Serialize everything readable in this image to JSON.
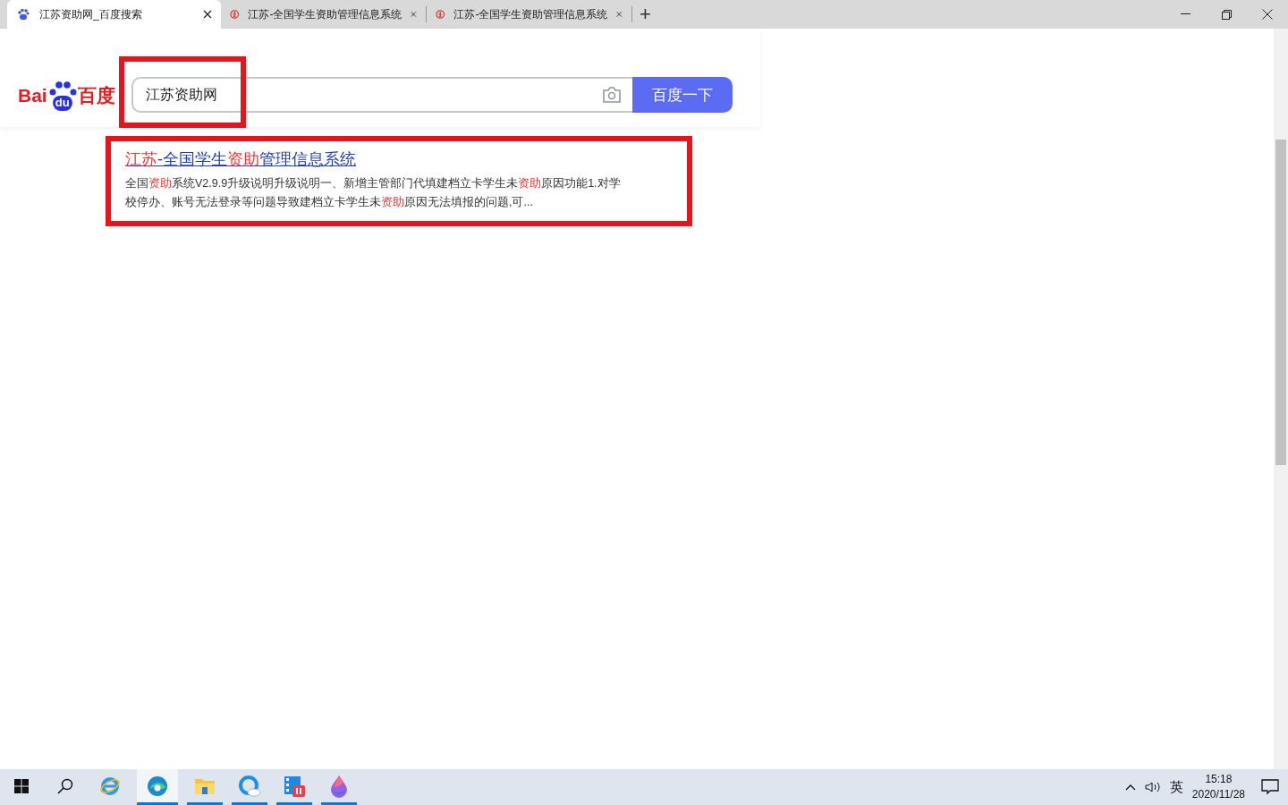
{
  "tabs": [
    {
      "title": "江苏资助网_百度搜索",
      "kind": "paw",
      "selected": true
    },
    {
      "title": "江苏-全国学生资助管理信息系统",
      "kind": "emblem",
      "selected": false
    },
    {
      "title": "江苏-全国学生资助管理信息系统",
      "kind": "emblem",
      "selected": false
    }
  ],
  "new_tab": "+",
  "logo": {
    "left": "Bai",
    "paw": "du",
    "right": "百度"
  },
  "search": {
    "value": "江苏资助网",
    "highlighted": true,
    "button": "百度一下"
  },
  "results": [
    {
      "highlighted": true,
      "title": [
        {
          "text": "江苏",
          "match": true
        },
        {
          "text": "-全国学生",
          "match": false
        },
        {
          "text": "资助",
          "match": true
        },
        {
          "text": "管理信息系统",
          "match": false
        }
      ],
      "snippet": [
        {
          "text": "全国",
          "match": false
        },
        {
          "text": "资助",
          "match": true
        },
        {
          "text": "系统V2.9.9升级说明升级说明一、新增主管部门代填建档立卡学生未",
          "match": false
        },
        {
          "text": "资助",
          "match": true
        },
        {
          "text": "原因功能1.对学校停办、账号无法登录等问题导致建档立卡学生未",
          "match": false
        },
        {
          "text": "资助",
          "match": true
        },
        {
          "text": "原因无法填报的问题,可...",
          "match": false
        }
      ]
    }
  ],
  "taskbar": {
    "apps": [
      {
        "kind": "ie",
        "selected": false,
        "running": false
      },
      {
        "kind": "edge",
        "selected": true,
        "running": true
      },
      {
        "kind": "folder",
        "selected": false,
        "running": true
      },
      {
        "kind": "qq",
        "selected": false,
        "running": true
      },
      {
        "kind": "recorder",
        "selected": false,
        "running": true
      },
      {
        "kind": "drop",
        "selected": false,
        "running": true
      }
    ],
    "ime": "英",
    "time": "15:18",
    "date": "2020/11/28"
  }
}
